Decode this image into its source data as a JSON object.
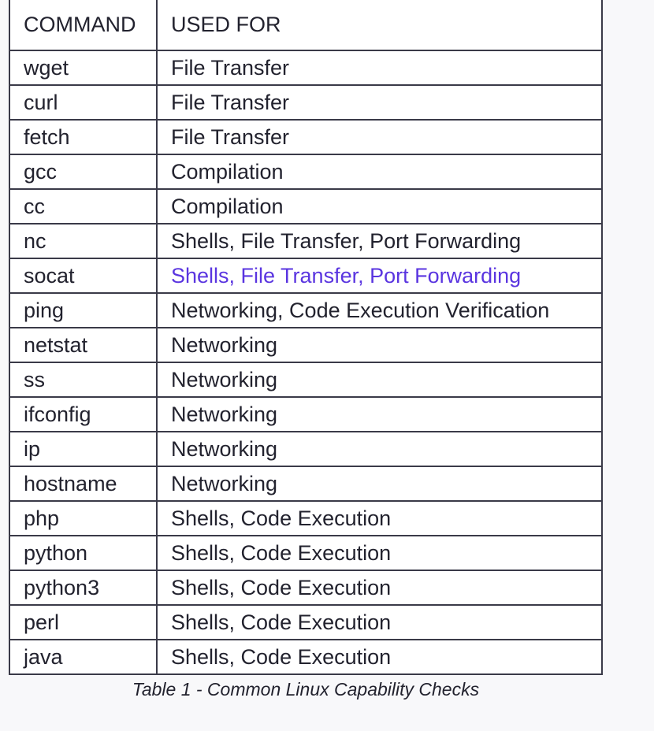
{
  "table": {
    "headers": [
      "COMMAND",
      "USED FOR"
    ],
    "rows": [
      {
        "command": "wget",
        "used_for": "File Transfer"
      },
      {
        "command": "curl",
        "used_for": "File Transfer"
      },
      {
        "command": "fetch",
        "used_for": "File Transfer"
      },
      {
        "command": "gcc",
        "used_for": "Compilation"
      },
      {
        "command": "cc",
        "used_for": "Compilation"
      },
      {
        "command": "nc",
        "used_for": "Shells, File Transfer, Port Forwarding"
      },
      {
        "command": "socat",
        "used_for": "Shells, File Transfer, Port Forwarding"
      },
      {
        "command": "ping",
        "used_for": "Networking, Code Execution Verification"
      },
      {
        "command": "netstat",
        "used_for": "Networking"
      },
      {
        "command": "ss",
        "used_for": "Networking"
      },
      {
        "command": "ifconfig",
        "used_for": "Networking"
      },
      {
        "command": "ip",
        "used_for": "Networking"
      },
      {
        "command": "hostname",
        "used_for": "Networking"
      },
      {
        "command": "php",
        "used_for": "Shells, Code Execution"
      },
      {
        "command": "python",
        "used_for": "Shells, Code Execution"
      },
      {
        "command": "python3",
        "used_for": "Shells, Code Execution"
      },
      {
        "command": "perl",
        "used_for": "Shells, Code Execution"
      },
      {
        "command": "java",
        "used_for": "Shells, Code Execution"
      }
    ]
  },
  "caption": "Table 1 - Common Linux Capability Checks",
  "colors": {
    "highlight_text": "#5a35e0",
    "border": "#3a3a48",
    "text": "#22222e"
  }
}
